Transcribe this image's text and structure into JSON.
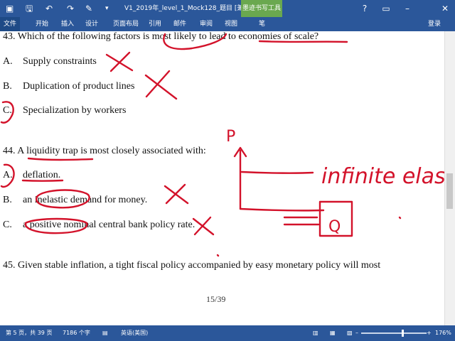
{
  "titlebar": {
    "title": "V1_2019年_level_1_Mock128_题目 [兼容模...",
    "tool_tab": "墨迹书写工具",
    "icons": [
      "word-logo-icon",
      "save-icon",
      "undo-icon",
      "redo-icon",
      "pen-icon",
      "dropdown-icon",
      "help-icon",
      "ribbon-display-icon",
      "minimize-icon",
      "close-icon"
    ]
  },
  "ribbon": {
    "tabs": [
      "文件",
      "开始",
      "插入",
      "设计",
      "页面布局",
      "引用",
      "邮件",
      "审阅",
      "视图",
      "笔"
    ],
    "login": "登录"
  },
  "document": {
    "q43": "43.  Which of the following factors is most likely to lead to economies of scale?",
    "q43_options": [
      {
        "letter": "A.",
        "text": "Supply constraints"
      },
      {
        "letter": "B.",
        "text": "Duplication of product lines"
      },
      {
        "letter": "C.",
        "text": "Specialization by workers"
      }
    ],
    "q44": "44.  A liquidity trap is most closely associated with:",
    "q44_options": [
      {
        "letter": "A.",
        "text": "deflation."
      },
      {
        "letter": "B.",
        "text": "an inelastic demand for money."
      },
      {
        "letter": "C.",
        "text": "a positive nominal central bank policy rate."
      }
    ],
    "q45": "45.  Given stable inflation, a tight fiscal policy accompanied by easy monetary policy will most",
    "page_number": "15/39",
    "handwriting": {
      "p_label": "P",
      "q_label": "Q",
      "note": "infinite elastic"
    },
    "ink_color": "#d3122a"
  },
  "status": {
    "page": "第 5 页，共 39 页",
    "words": "7186 个字",
    "language": "英语(美国)",
    "zoom": "176%"
  },
  "colors": {
    "accent": "#2b579a",
    "tool_tab": "#6aa84f"
  }
}
